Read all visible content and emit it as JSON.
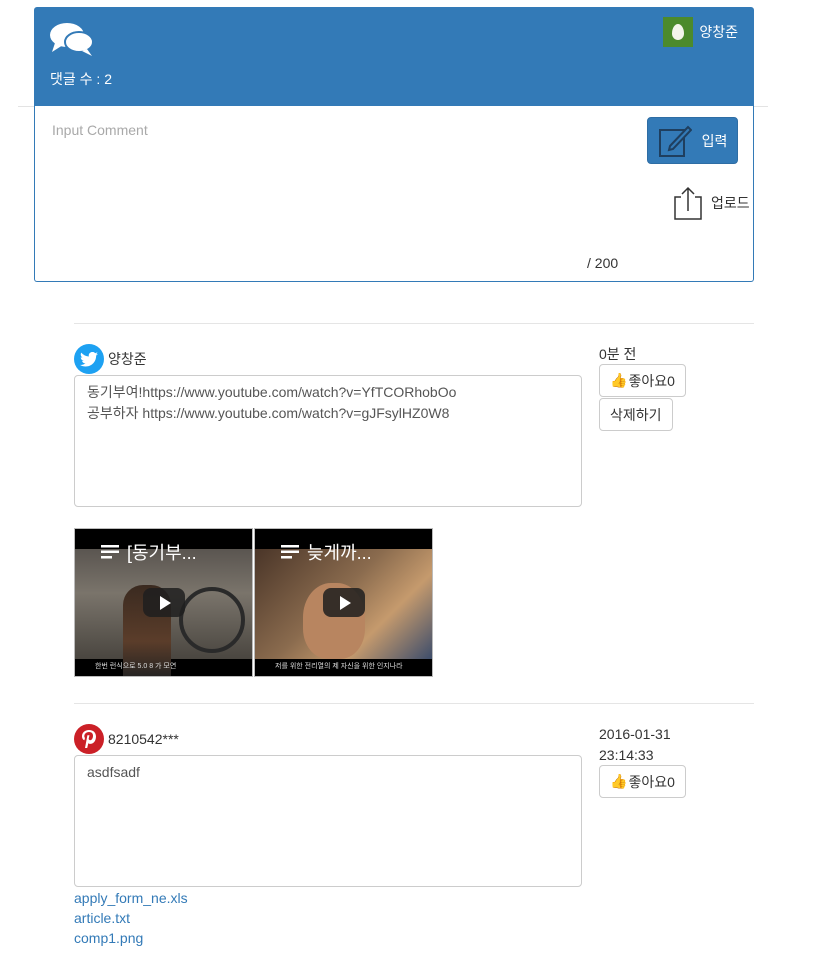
{
  "header": {
    "count_label": "댓글 수 : 2",
    "user_name": "양창준"
  },
  "input": {
    "placeholder": "Input Comment",
    "submit_label": "입력",
    "upload_label": "업로드",
    "char_count": "/ 200"
  },
  "comments": [
    {
      "author": "양창준",
      "avatar": "twitter-icon",
      "text": "동기부여!https://www.youtube.com/watch?v=YfTCORhobOo\n공부하자 https://www.youtube.com/watch?v=gJFsylHZ0W8",
      "time": "0분 전",
      "like_label": "좋아요0",
      "delete_label": "삭제하기",
      "videos": [
        {
          "title": "[동기부..."
        },
        {
          "title": "늦게까..."
        }
      ]
    },
    {
      "author": "8210542***",
      "avatar": "pinterest-icon",
      "text": "asdfsadf",
      "time_date": "2016-01-31",
      "time_clock": "23:14:33",
      "like_label": "좋아요0",
      "files": [
        "apply_form_ne.xls",
        "article.txt",
        "comp1.png"
      ]
    }
  ],
  "colors": {
    "primary": "#337ab7",
    "border": "#cccccc",
    "twitter": "#1da1f2",
    "pinterest": "#cb2027",
    "egg_bg": "#4c8a2c"
  }
}
